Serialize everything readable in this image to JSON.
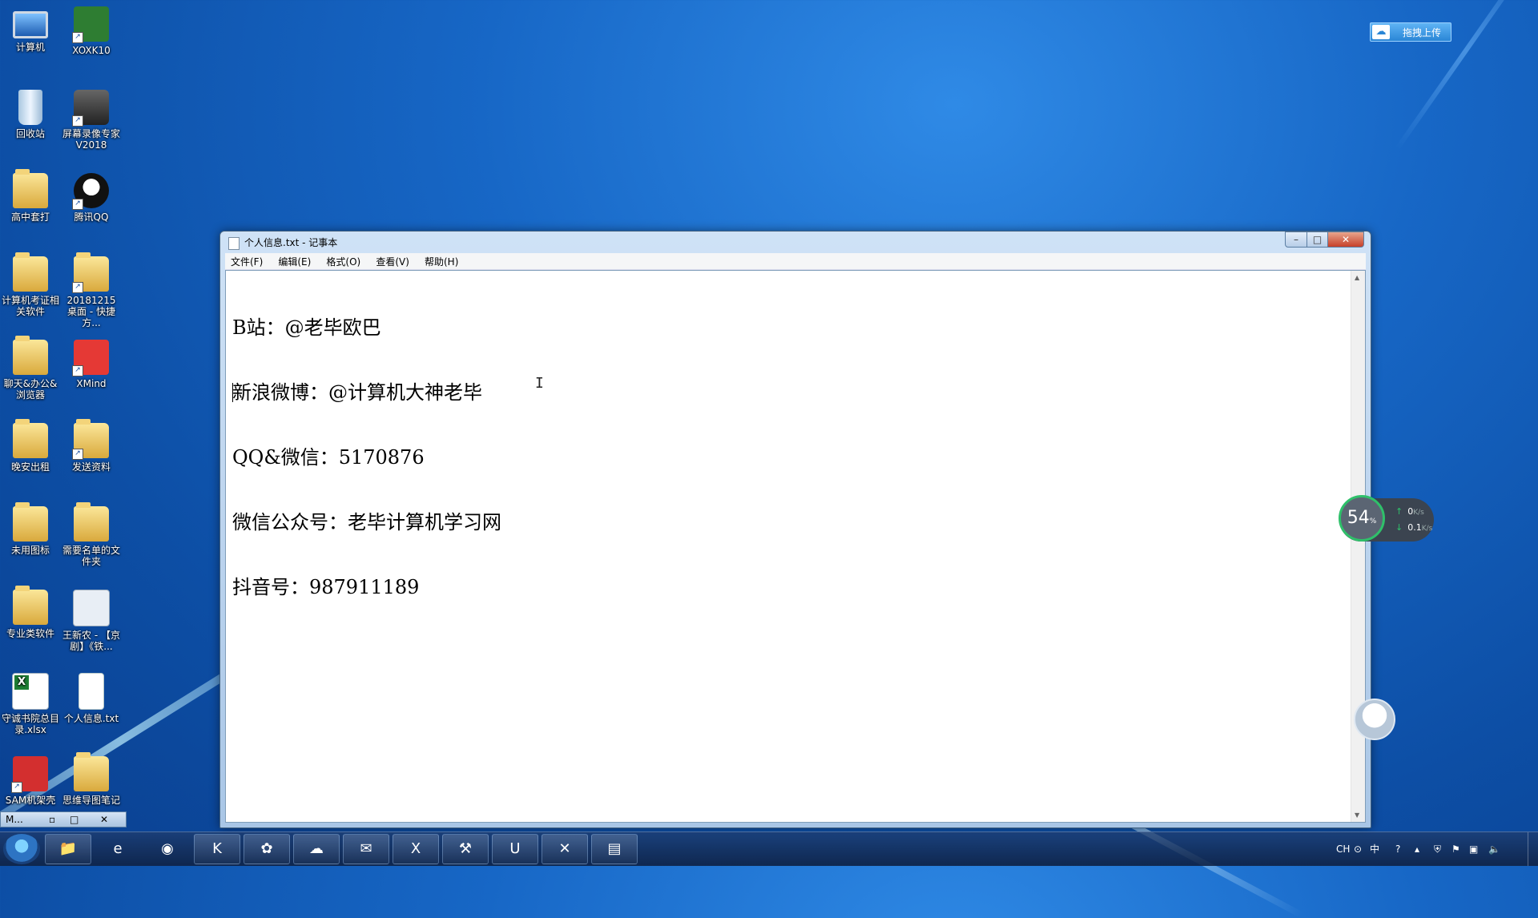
{
  "desktop": {
    "icons": [
      {
        "label": "计算机",
        "icon": "computer-icon"
      },
      {
        "label": "XOXK10",
        "icon": "app-icon"
      },
      {
        "label": "回收站",
        "icon": "recycle-bin-icon"
      },
      {
        "label": "屏幕录像专家 V2018",
        "icon": "camera-icon"
      },
      {
        "label": "高中套打",
        "icon": "folder-icon"
      },
      {
        "label": "腾讯QQ",
        "icon": "qq-icon"
      },
      {
        "label": "计算机考证相关软件",
        "icon": "folder-icon"
      },
      {
        "label": "20181215 桌面 - 快捷方...",
        "icon": "folder-icon"
      },
      {
        "label": "聊天&办公&浏览器",
        "icon": "folder-icon"
      },
      {
        "label": "XMind",
        "icon": "xmind-icon"
      },
      {
        "label": "晚安出租",
        "icon": "folder-icon"
      },
      {
        "label": "发送资料",
        "icon": "folder-icon"
      },
      {
        "label": "未用图标",
        "icon": "folder-icon"
      },
      {
        "label": "需要名单的文件夹",
        "icon": "folder-icon"
      },
      {
        "label": "专业类软件",
        "icon": "folder-icon"
      },
      {
        "label": "王新农 - 【京剧】《铁...",
        "icon": "mp3-icon"
      },
      {
        "label": "守诚书院总目录.xlsx",
        "icon": "excel-icon"
      },
      {
        "label": "个人信息.txt",
        "icon": "text-file-icon"
      },
      {
        "label": "SAM机架壳",
        "icon": "sam-icon"
      },
      {
        "label": "思维导图笔记",
        "icon": "folder-icon"
      }
    ]
  },
  "upload_widget": {
    "label": "拖拽上传"
  },
  "notepad": {
    "title": "个人信息.txt - 记事本",
    "menu": [
      "文件(F)",
      "编辑(E)",
      "格式(O)",
      "查看(V)",
      "帮助(H)"
    ],
    "lines": [
      "B站：@老毕欧巴",
      "新浪微博：@计算机大神老毕",
      "QQ&微信：5170876",
      "微信公众号：老毕计算机学习网",
      "抖音号：987911189"
    ],
    "buttons": {
      "minimize": "–",
      "maximize": "□",
      "close": "✕"
    }
  },
  "netmon": {
    "percent": "54",
    "percent_unit": "%",
    "up": "0",
    "down": "0.1",
    "unit": "K/s"
  },
  "mini_window": {
    "label": "M...",
    "restore": "▫",
    "max": "□",
    "close": "✕"
  },
  "taskbar": {
    "apps": [
      "explorer-icon",
      "ie-icon",
      "chrome-icon",
      "kugou-icon",
      "game-icon",
      "baidu-cloud-icon",
      "wechat-icon",
      "excel-icon",
      "tools-icon",
      "u-icon",
      "xmind-icon",
      "notepad-icon"
    ],
    "tray": {
      "lang": "CH",
      "ime": "中"
    }
  }
}
